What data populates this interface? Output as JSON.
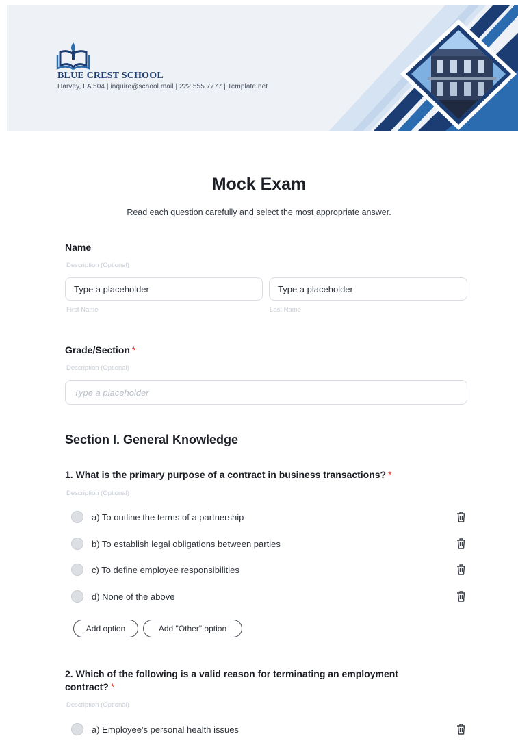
{
  "header": {
    "school_name": "BLUE CREST SCHOOL",
    "contact": "Harvey, LA 504 | inquire@school.mail | 222 555 7777 | Template.net",
    "colors": {
      "navy": "#1b3d73",
      "blue": "#2b6cb0",
      "light_blue": "#cfe0f3",
      "banner_bg": "#eef1f6"
    }
  },
  "form": {
    "title": "Mock Exam",
    "subtitle": "Read each question carefully and select the most appropriate answer.",
    "name_field": {
      "label": "Name",
      "description": "Description (Optional)",
      "first_placeholder": "Type a placeholder",
      "last_placeholder": "Type a placeholder",
      "first_helper": "First Name",
      "last_helper": "Last Name"
    },
    "grade_field": {
      "label": "Grade/Section",
      "required_mark": "*",
      "description": "Description (Optional)",
      "placeholder": "Type a placeholder"
    },
    "section_title": "Section I. General Knowledge",
    "questions": [
      {
        "title": "1. What is the primary purpose of a contract in business transactions?",
        "required_mark": "*",
        "description": "Description (Optional)",
        "options": [
          "a) To outline the terms of a partnership",
          "b) To establish legal obligations between parties",
          "c) To define employee responsibilities",
          "d) None of the above"
        ],
        "add_option_label": "Add option",
        "add_other_label": "Add \"Other\" option"
      },
      {
        "title_line1": "2. Which of the following is a valid reason for terminating an employment",
        "title_line2": "contract?",
        "required_mark": "*",
        "description": "Description (Optional)",
        "options": [
          "a) Employee's personal health issues"
        ]
      }
    ]
  }
}
